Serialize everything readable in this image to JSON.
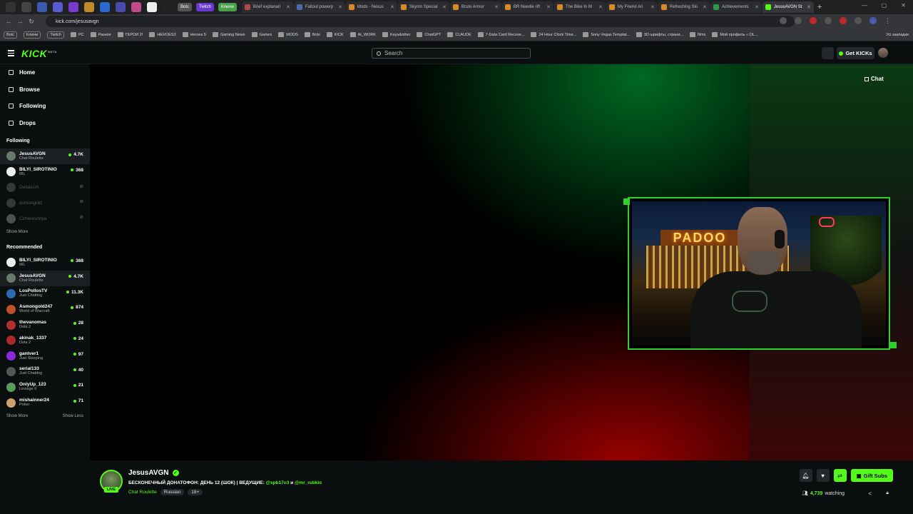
{
  "browser": {
    "pinned": [
      "Botc",
      "Twitch",
      "Ключи"
    ],
    "tabs": [
      {
        "label": "Brief explanati",
        "color": "#b04848"
      },
      {
        "label": "Fallout powerp",
        "color": "#4a6ab0"
      },
      {
        "label": "Mods - Nexus",
        "color": "#d88a2a"
      },
      {
        "label": "Skyrim Special",
        "color": "#d88a2a"
      },
      {
        "label": "Brute Armor",
        "color": "#d88a2a"
      },
      {
        "label": "BR Needle rifl",
        "color": "#d88a2a"
      },
      {
        "label": "The Bike In M",
        "color": "#d88a2a"
      },
      {
        "label": "My Friend Ari",
        "color": "#d88a2a"
      },
      {
        "label": "Refreshing Ski",
        "color": "#d88a2a"
      },
      {
        "label": "Achievements",
        "color": "#2a9a4a"
      },
      {
        "label": "JesusAVGN St",
        "color": "#53fc18",
        "active": true
      }
    ],
    "url": "kick.com/jesusavgn",
    "bookmarks": [
      "Botc",
      "Ключи",
      "Twitch",
      "PC",
      "Разное",
      "ГЕРОИ 2!",
      "HEROES3",
      "Heroes 5",
      "Gaming News",
      "Games",
      "MODS",
      "Bots",
      "KICK",
      "AI_WORK",
      "Keys&other",
      "ChatGPT",
      "CLAUDE",
      "7-Data Card Recove...",
      "24 Hour Clock Time...",
      "Sony Vegas Templat...",
      "3D шрифты, страни...",
      "films",
      "Мой профиль « OL..."
    ],
    "all_bookmarks": "Усі закладки"
  },
  "header": {
    "logo": "KICK",
    "logo_badge": "BETA",
    "search_placeholder": "Search",
    "get_kicks": "Get KICKs"
  },
  "sidebar": {
    "nav": [
      {
        "label": "Home",
        "icon": "home-icon"
      },
      {
        "label": "Browse",
        "icon": "browse-icon"
      },
      {
        "label": "Following",
        "icon": "heart-icon"
      },
      {
        "label": "Drops",
        "icon": "drops-icon"
      }
    ],
    "following_title": "Following",
    "following": [
      {
        "name": "JesusAVGN",
        "game": "Chat Roulette",
        "viewers": "4.7K",
        "color": "#6a7a6a",
        "selected": true
      },
      {
        "name": "BILYI_SIROTINIO",
        "game": "IRL",
        "viewers": "368",
        "color": "#eeeeee"
      },
      {
        "name": "DeltasUA",
        "game": "",
        "viewers": "",
        "color": "#888888",
        "offline": true
      },
      {
        "name": "asmongold",
        "game": "",
        "viewers": "",
        "color": "#888888",
        "offline": true
      },
      {
        "name": "Ccheresnnya",
        "game": "",
        "viewers": "",
        "color": "#cccccc",
        "offline": true
      }
    ],
    "show_more": "Show More",
    "recommended_title": "Recommended",
    "recommended": [
      {
        "name": "BILYI_SIROTINIO",
        "game": "IRL",
        "viewers": "368",
        "color": "#eeeeee"
      },
      {
        "name": "JesusAVGN",
        "game": "Chat Roulette",
        "viewers": "4.7K",
        "color": "#6a7a6a",
        "selected": true
      },
      {
        "name": "LosPollosTV",
        "game": "Just Chatting",
        "viewers": "11.3K",
        "color": "#2a6ab0"
      },
      {
        "name": "Asmongold247",
        "game": "World of Warcraft",
        "viewers": "874",
        "color": "#c0502a"
      },
      {
        "name": "thevanomas",
        "game": "Dota 2",
        "viewers": "28",
        "color": "#b03030"
      },
      {
        "name": "akinak_1337",
        "game": "Dota 2",
        "viewers": "24",
        "color": "#aa2a2a"
      },
      {
        "name": "gantver1",
        "game": "Just Sleeping",
        "viewers": "97",
        "color": "#8a2ad8"
      },
      {
        "name": "serial133",
        "game": "Just Chatting",
        "viewers": "40",
        "color": "#555555"
      },
      {
        "name": "OnlyUp_123",
        "game": "Lineage II",
        "viewers": "21",
        "color": "#5a9a5a"
      },
      {
        "name": "mishainner24",
        "game": "Poker",
        "viewers": "71",
        "color": "#d0a070"
      }
    ],
    "show_more_2": "Show More",
    "show_less": "Show Less"
  },
  "video": {
    "chat_label": "Chat",
    "cam_sign": "PADOO"
  },
  "channel": {
    "live_badge": "LIVE",
    "name": "JesusAVGN",
    "title_prefix": "БЕСКОНЕЧНЫЙ ДОНАТОФОН: ДЕНЬ 12 (ШОК) | ВЕДУЩИЕ:",
    "host1": "@spb17o3",
    "title_and": "и",
    "host2": "@mr_rubkio",
    "category": "Chat Roulette",
    "tags": [
      "Russian",
      "18+"
    ],
    "gift_subs": "Gift Subs",
    "viewers": "4,739",
    "watching_label": "watching"
  }
}
